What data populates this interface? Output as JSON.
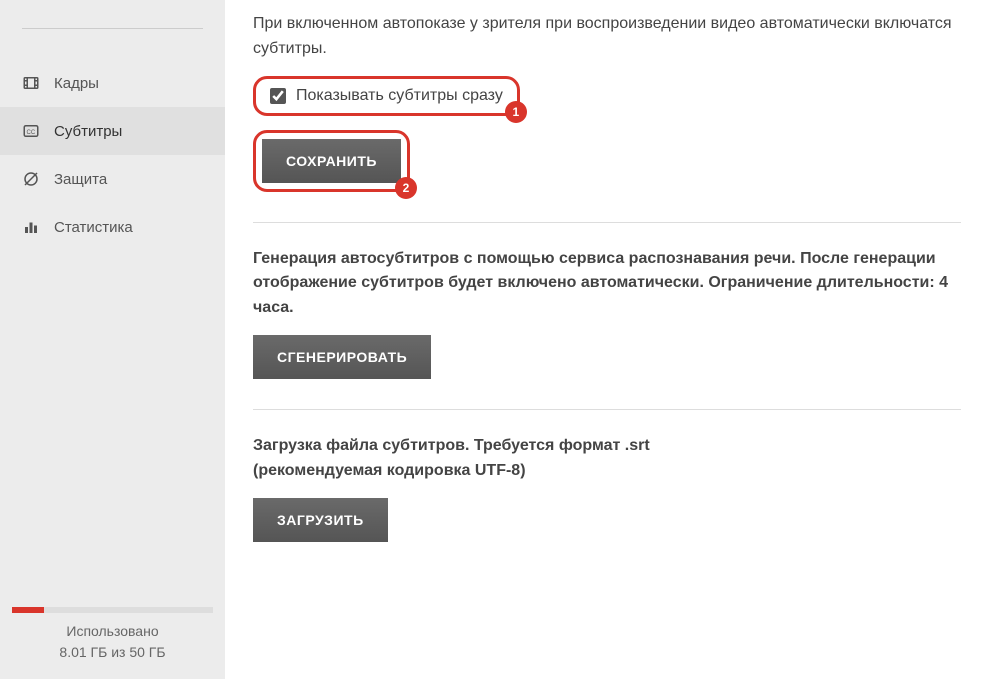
{
  "sidebar": {
    "items": [
      {
        "label": "Кадры"
      },
      {
        "label": "Субтитры"
      },
      {
        "label": "Защита"
      },
      {
        "label": "Статистика"
      }
    ]
  },
  "storage": {
    "used_label": "Использовано",
    "usage_text": "8.01 ГБ из 50 ГБ",
    "percent": 16
  },
  "autoshow": {
    "description": "При включенном автопоказе у зрителя при воспроизведении видео автоматически включатся субтитры.",
    "checkbox_label": "Показывать субтитры сразу",
    "save_button": "СОХРАНИТЬ"
  },
  "annotations": {
    "badge1": "1",
    "badge2": "2"
  },
  "generate": {
    "description": "Генерация автосубтитров с помощью сервиса распознавания речи. После генерации отображение субтитров будет включено автоматически. Ограничение длительности: 4 часа.",
    "button": "СГЕНЕРИРОВАТЬ"
  },
  "upload": {
    "line1": "Загрузка файла субтитров. Требуется формат .srt",
    "line2": "(рекомендуемая кодировка UTF-8)",
    "button": "ЗАГРУЗИТЬ"
  }
}
